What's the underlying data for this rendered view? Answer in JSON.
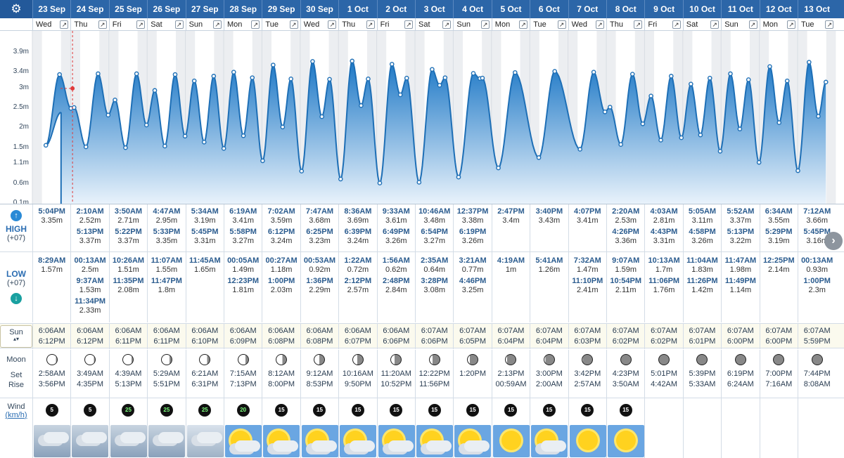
{
  "labels": {
    "high": "HIGH",
    "low": "LOW",
    "tz": "(+07)",
    "sun": "Sun",
    "moon": "Moon",
    "set": "Set",
    "rise": "Rise",
    "wind": "Wind",
    "unit": "km/h"
  },
  "y_axis": [
    "3.9m",
    "3.4m",
    "3m",
    "2.5m",
    "2m",
    "1.5m",
    "1.1m",
    "0.6m",
    "0.1m"
  ],
  "days": [
    {
      "date": "23 Sep",
      "dow": "Wed",
      "high": [
        {
          "t": "5:04PM",
          "h": "3.35m"
        }
      ],
      "low": [
        {
          "t": "8:29AM",
          "h": "1.57m"
        }
      ],
      "sunrise": "6:06AM",
      "sunset": "6:12PM",
      "moonset": "2:58AM",
      "moonrise": "3:56PM",
      "wind": "5",
      "weather": "storm"
    },
    {
      "date": "24 Sep",
      "dow": "Thu",
      "high": [
        {
          "t": "2:10AM",
          "h": "2.52m"
        },
        {
          "t": "5:13PM",
          "h": "3.37m"
        }
      ],
      "low": [
        {
          "t": "00:13AM",
          "h": "2.5m"
        },
        {
          "t": "9:37AM",
          "h": "1.53m"
        },
        {
          "t": "11:34PM",
          "h": "2.33m"
        }
      ],
      "sunrise": "6:06AM",
      "sunset": "6:12PM",
      "moonset": "3:49AM",
      "moonrise": "4:35PM",
      "wind": "5",
      "weather": "storm"
    },
    {
      "date": "25 Sep",
      "dow": "Fri",
      "high": [
        {
          "t": "3:50AM",
          "h": "2.71m"
        },
        {
          "t": "5:22PM",
          "h": "3.37m"
        }
      ],
      "low": [
        {
          "t": "10:26AM",
          "h": "1.51m"
        },
        {
          "t": "11:35PM",
          "h": "2.08m"
        }
      ],
      "sunrise": "6:06AM",
      "sunset": "6:11PM",
      "moonset": "4:39AM",
      "moonrise": "5:13PM",
      "wind": "25",
      "weather": "storm"
    },
    {
      "date": "26 Sep",
      "dow": "Sat",
      "high": [
        {
          "t": "4:47AM",
          "h": "2.95m"
        },
        {
          "t": "5:33PM",
          "h": "3.35m"
        }
      ],
      "low": [
        {
          "t": "11:07AM",
          "h": "1.55m"
        },
        {
          "t": "11:47PM",
          "h": "1.8m"
        }
      ],
      "sunrise": "6:06AM",
      "sunset": "6:11PM",
      "moonset": "5:29AM",
      "moonrise": "5:51PM",
      "wind": "25",
      "weather": "storm"
    },
    {
      "date": "27 Sep",
      "dow": "Sun",
      "high": [
        {
          "t": "5:34AM",
          "h": "3.19m"
        },
        {
          "t": "5:45PM",
          "h": "3.31m"
        }
      ],
      "low": [
        {
          "t": "11:45AM",
          "h": "1.65m"
        }
      ],
      "sunrise": "6:06AM",
      "sunset": "6:10PM",
      "moonset": "6:21AM",
      "moonrise": "6:31PM",
      "wind": "25",
      "weather": "cloud"
    },
    {
      "date": "28 Sep",
      "dow": "Mon",
      "high": [
        {
          "t": "6:19AM",
          "h": "3.41m"
        },
        {
          "t": "5:58PM",
          "h": "3.27m"
        }
      ],
      "low": [
        {
          "t": "00:05AM",
          "h": "1.49m"
        },
        {
          "t": "12:23PM",
          "h": "1.81m"
        }
      ],
      "sunrise": "6:06AM",
      "sunset": "6:09PM",
      "moonset": "7:15AM",
      "moonrise": "7:13PM",
      "wind": "20",
      "weather": "suncloudrain"
    },
    {
      "date": "29 Sep",
      "dow": "Tue",
      "high": [
        {
          "t": "7:02AM",
          "h": "3.59m"
        },
        {
          "t": "6:12PM",
          "h": "3.24m"
        }
      ],
      "low": [
        {
          "t": "00:27AM",
          "h": "1.18m"
        },
        {
          "t": "1:00PM",
          "h": "2.03m"
        }
      ],
      "sunrise": "6:06AM",
      "sunset": "6:08PM",
      "moonset": "8:12AM",
      "moonrise": "8:00PM",
      "wind": "15",
      "weather": "suncloud"
    },
    {
      "date": "30 Sep",
      "dow": "Wed",
      "high": [
        {
          "t": "7:47AM",
          "h": "3.68m"
        },
        {
          "t": "6:25PM",
          "h": "3.23m"
        }
      ],
      "low": [
        {
          "t": "00:53AM",
          "h": "0.92m"
        },
        {
          "t": "1:36PM",
          "h": "2.29m"
        }
      ],
      "sunrise": "6:06AM",
      "sunset": "6:08PM",
      "moonset": "9:12AM",
      "moonrise": "8:53PM",
      "wind": "15",
      "weather": "suncloud"
    },
    {
      "date": "1 Oct",
      "dow": "Thu",
      "high": [
        {
          "t": "8:36AM",
          "h": "3.69m"
        },
        {
          "t": "6:39PM",
          "h": "3.24m"
        }
      ],
      "low": [
        {
          "t": "1:22AM",
          "h": "0.72m"
        },
        {
          "t": "2:12PM",
          "h": "2.57m"
        }
      ],
      "sunrise": "6:06AM",
      "sunset": "6:07PM",
      "moonset": "10:16AM",
      "moonrise": "9:50PM",
      "wind": "15",
      "weather": "suncloud"
    },
    {
      "date": "2 Oct",
      "dow": "Fri",
      "high": [
        {
          "t": "9:33AM",
          "h": "3.61m"
        },
        {
          "t": "6:49PM",
          "h": "3.26m"
        }
      ],
      "low": [
        {
          "t": "1:56AM",
          "h": "0.62m"
        },
        {
          "t": "2:48PM",
          "h": "2.84m"
        }
      ],
      "sunrise": "6:06AM",
      "sunset": "6:06PM",
      "moonset": "11:20AM",
      "moonrise": "10:52PM",
      "wind": "15",
      "weather": "suncloud"
    },
    {
      "date": "3 Oct",
      "dow": "Sat",
      "high": [
        {
          "t": "10:46AM",
          "h": "3.48m"
        },
        {
          "t": "6:54PM",
          "h": "3.27m"
        }
      ],
      "low": [
        {
          "t": "2:35AM",
          "h": "0.64m"
        },
        {
          "t": "3:28PM",
          "h": "3.08m"
        }
      ],
      "sunrise": "6:07AM",
      "sunset": "6:06PM",
      "moonset": "12:22PM",
      "moonrise": "11:56PM",
      "wind": "15",
      "weather": "suncloud"
    },
    {
      "date": "4 Oct",
      "dow": "Sun",
      "high": [
        {
          "t": "12:37PM",
          "h": "3.38m"
        },
        {
          "t": "6:19PM",
          "h": "3.26m"
        }
      ],
      "low": [
        {
          "t": "3:21AM",
          "h": "0.77m"
        },
        {
          "t": "4:46PM",
          "h": "3.25m"
        }
      ],
      "sunrise": "6:07AM",
      "sunset": "6:05PM",
      "moonset": "1:20PM",
      "moonrise": "",
      "wind": "15",
      "weather": "suncloud"
    },
    {
      "date": "5 Oct",
      "dow": "Mon",
      "high": [
        {
          "t": "2:47PM",
          "h": "3.4m"
        }
      ],
      "low": [
        {
          "t": "4:19AM",
          "h": "1m"
        }
      ],
      "sunrise": "6:07AM",
      "sunset": "6:04PM",
      "moonset": "2:13PM",
      "moonrise": "00:59AM",
      "wind": "15",
      "weather": "sun"
    },
    {
      "date": "6 Oct",
      "dow": "Tue",
      "high": [
        {
          "t": "3:40PM",
          "h": "3.43m"
        }
      ],
      "low": [
        {
          "t": "5:41AM",
          "h": "1.26m"
        }
      ],
      "sunrise": "6:07AM",
      "sunset": "6:04PM",
      "moonset": "3:00PM",
      "moonrise": "2:00AM",
      "wind": "15",
      "weather": "suncloud"
    },
    {
      "date": "7 Oct",
      "dow": "Wed",
      "high": [
        {
          "t": "4:07PM",
          "h": "3.41m"
        }
      ],
      "low": [
        {
          "t": "7:32AM",
          "h": "1.47m"
        },
        {
          "t": "11:10PM",
          "h": "2.41m"
        }
      ],
      "sunrise": "6:07AM",
      "sunset": "6:03PM",
      "moonset": "3:42PM",
      "moonrise": "2:57AM",
      "wind": "15",
      "weather": "sun"
    },
    {
      "date": "8 Oct",
      "dow": "Thu",
      "high": [
        {
          "t": "2:20AM",
          "h": "2.53m"
        },
        {
          "t": "4:26PM",
          "h": "3.36m"
        }
      ],
      "low": [
        {
          "t": "9:07AM",
          "h": "1.59m"
        },
        {
          "t": "10:54PM",
          "h": "2.11m"
        }
      ],
      "sunrise": "6:07AM",
      "sunset": "6:02PM",
      "moonset": "4:23PM",
      "moonrise": "3:50AM",
      "wind": "15",
      "weather": "sun"
    },
    {
      "date": "9 Oct",
      "dow": "Fri",
      "high": [
        {
          "t": "4:03AM",
          "h": "2.81m"
        },
        {
          "t": "4:43PM",
          "h": "3.31m"
        }
      ],
      "low": [
        {
          "t": "10:13AM",
          "h": "1.7m"
        },
        {
          "t": "11:06PM",
          "h": "1.76m"
        }
      ],
      "sunrise": "6:07AM",
      "sunset": "6:02PM",
      "moonset": "5:01PM",
      "moonrise": "4:42AM",
      "wind": "",
      "weather": ""
    },
    {
      "date": "10 Oct",
      "dow": "Sat",
      "high": [
        {
          "t": "5:05AM",
          "h": "3.11m"
        },
        {
          "t": "4:58PM",
          "h": "3.26m"
        }
      ],
      "low": [
        {
          "t": "11:04AM",
          "h": "1.83m"
        },
        {
          "t": "11:26PM",
          "h": "1.42m"
        }
      ],
      "sunrise": "6:07AM",
      "sunset": "6:01PM",
      "moonset": "5:39PM",
      "moonrise": "5:33AM",
      "wind": "",
      "weather": ""
    },
    {
      "date": "11 Oct",
      "dow": "Sun",
      "high": [
        {
          "t": "5:52AM",
          "h": "3.37m"
        },
        {
          "t": "5:13PM",
          "h": "3.22m"
        }
      ],
      "low": [
        {
          "t": "11:47AM",
          "h": "1.98m"
        },
        {
          "t": "11:49PM",
          "h": "1.14m"
        }
      ],
      "sunrise": "6:07AM",
      "sunset": "6:00PM",
      "moonset": "6:19PM",
      "moonrise": "6:24AM",
      "wind": "",
      "weather": ""
    },
    {
      "date": "12 Oct",
      "dow": "Mon",
      "high": [
        {
          "t": "6:34AM",
          "h": "3.55m"
        },
        {
          "t": "5:29PM",
          "h": "3.19m"
        }
      ],
      "low": [
        {
          "t": "12:25PM",
          "h": "2.14m"
        }
      ],
      "sunrise": "6:07AM",
      "sunset": "6:00PM",
      "moonset": "7:00PM",
      "moonrise": "7:16AM",
      "wind": "",
      "weather": ""
    },
    {
      "date": "13 Oct",
      "dow": "Tue",
      "high": [
        {
          "t": "7:12AM",
          "h": "3.66m"
        },
        {
          "t": "5:45PM",
          "h": "3.16m"
        }
      ],
      "low": [
        {
          "t": "00:13AM",
          "h": "0.93m"
        },
        {
          "t": "1:00PM",
          "h": "2.3m"
        }
      ],
      "sunrise": "6:07AM",
      "sunset": "5:59PM",
      "moonset": "7:44PM",
      "moonrise": "8:08AM",
      "wind": "",
      "weather": ""
    }
  ],
  "chart_data": {
    "type": "area",
    "ylabel": "",
    "ylim": [
      0.1,
      4.2
    ],
    "series": [
      {
        "name": "",
        "points_note_free": true,
        "values": []
      }
    ]
  }
}
